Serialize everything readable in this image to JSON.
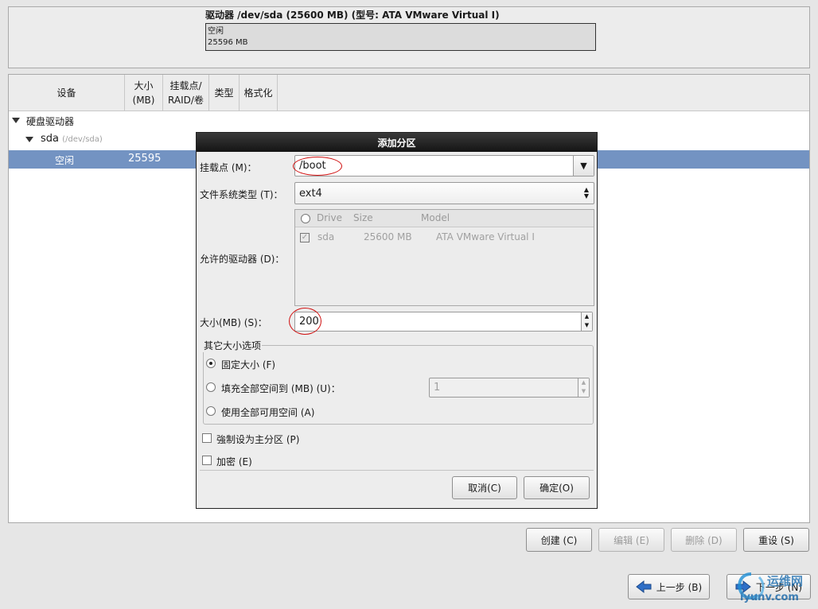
{
  "drive": {
    "title": "驱动器 /dev/sda (25600 MB) (型号: ATA VMware Virtual I)",
    "bar_line1": "空闲",
    "bar_line2": "25596 MB"
  },
  "tree": {
    "columns": [
      "设备",
      "大小\n(MB)",
      "挂载点/\nRAID/卷",
      "类型",
      "格式化"
    ],
    "group_label": "硬盘驱动器",
    "disk_name": "sda",
    "disk_path": "(/dev/sda)",
    "free_row": {
      "device": "空闲",
      "size": "25595"
    }
  },
  "dialog": {
    "title": "添加分区",
    "mount_label": "挂载点 (M)：",
    "mount_value": "/boot",
    "fstype_label": "文件系统类型 (T)：",
    "fstype_value": "ext4",
    "drives_label": "允许的驱动器 (D)：",
    "drive_columns": [
      "Drive",
      "Size",
      "Model"
    ],
    "drive_row": {
      "drive": "sda",
      "size": "25600 MB",
      "model": "ATA VMware Virtual I",
      "checked": true
    },
    "size_label": "大小(MB) (S)：",
    "size_value": "200",
    "other_options_title": "其它大小选项",
    "opt_fixed": "固定大小 (F)",
    "opt_fill_to": "填充全部空间到 (MB) (U)：",
    "opt_fill_to_value": "1",
    "opt_fill_all": "使用全部可用空间 (A)",
    "force_primary": "強制设为主分区 (P)",
    "encrypt": "加密 (E)",
    "cancel": "取消(C)",
    "ok": "确定(O)"
  },
  "actions": {
    "create": "创建 (C)",
    "edit": "编辑 (E)",
    "delete": "删除 (D)",
    "reset": "重设 (S)"
  },
  "nav": {
    "back": "上一步 (B)",
    "next": "下一步 (N)"
  },
  "watermark": {
    "line1": "运维网",
    "line2": "iyunv.com"
  }
}
